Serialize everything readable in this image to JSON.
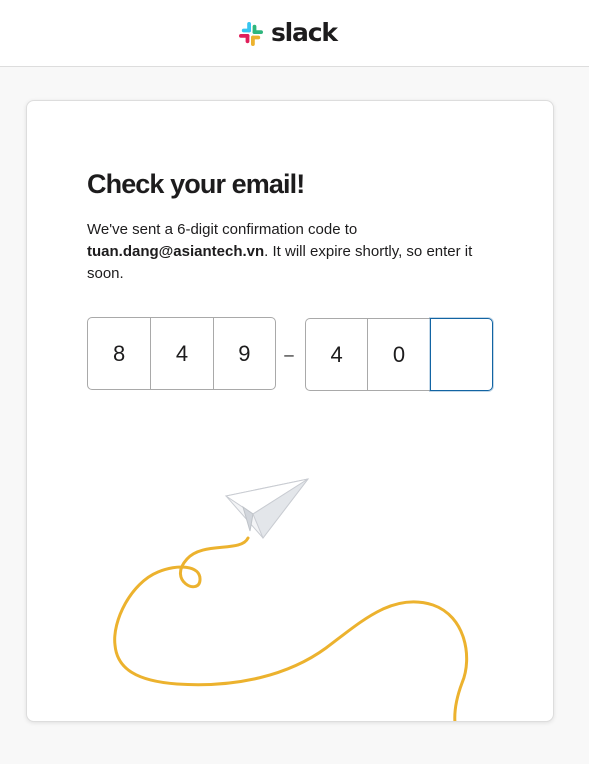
{
  "header": {
    "brand_name": "slack",
    "logo_icon": "slack-logo-icon",
    "colors": {
      "blue": "#36c5f0",
      "green": "#2eb67d",
      "yellow": "#ecb22e",
      "red": "#e01e5a"
    }
  },
  "card": {
    "title": "Check your email!",
    "description_prefix": "We've sent a 6-digit confirmation code to ",
    "email": "tuan.dang@asiantech.vn",
    "description_suffix": ". It will expire shortly, so enter it soon.",
    "code_digits": [
      "8",
      "4",
      "9",
      "4",
      "0",
      ""
    ],
    "separator": "–",
    "illustration_icon": "paper-plane-icon",
    "accent_color": "#1264a3",
    "trail_color": "#ecb22e"
  }
}
